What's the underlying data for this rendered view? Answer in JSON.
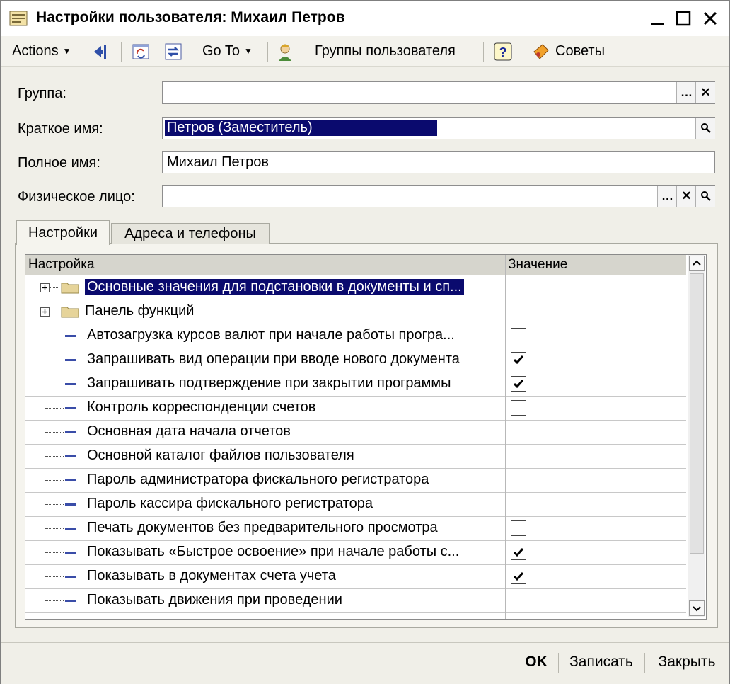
{
  "window": {
    "title": "Настройки пользователя: Михаил Петров"
  },
  "toolbar": {
    "actions": "Actions",
    "goto": "Go To",
    "groups": "Группы пользователя",
    "tips": "Советы"
  },
  "form": {
    "group_label": "Группа:",
    "group_value": "",
    "short_name_label": "Краткое имя:",
    "short_name_value": "Петров (Заместитель)",
    "full_name_label": "Полное имя:",
    "full_name_value": "Михаил Петров",
    "person_label": "Физическое лицо:",
    "person_value": ""
  },
  "tabs": [
    {
      "label": "Настройки",
      "active": true
    },
    {
      "label": "Адреса и телефоны",
      "active": false
    }
  ],
  "grid": {
    "col_setting": "Настройка",
    "col_value": "Значение",
    "rows": [
      {
        "label": "Основные значения для подстановки в документы и сп...",
        "kind": "folder",
        "selected": true,
        "checkbox": null
      },
      {
        "label": "Панель функций",
        "kind": "folder",
        "selected": false,
        "checkbox": null
      },
      {
        "label": "Автозагрузка курсов валют при начале работы програ...",
        "kind": "item",
        "checkbox": false
      },
      {
        "label": "Запрашивать вид операции при вводе нового документа",
        "kind": "item",
        "checkbox": true
      },
      {
        "label": "Запрашивать подтверждение при закрытии программы",
        "kind": "item",
        "checkbox": true
      },
      {
        "label": "Контроль корреспонденции счетов",
        "kind": "item",
        "checkbox": false
      },
      {
        "label": "Основная дата начала отчетов",
        "kind": "item",
        "checkbox": null
      },
      {
        "label": "Основной каталог файлов пользователя",
        "kind": "item",
        "checkbox": null
      },
      {
        "label": "Пароль администратора фискального регистратора",
        "kind": "item",
        "checkbox": null
      },
      {
        "label": "Пароль кассира фискального регистратора",
        "kind": "item",
        "checkbox": null
      },
      {
        "label": "Печать документов без предварительного просмотра",
        "kind": "item",
        "checkbox": false
      },
      {
        "label": "Показывать «Быстрое освоение» при начале работы с...",
        "kind": "item",
        "checkbox": true
      },
      {
        "label": "Показывать в документах счета учета",
        "kind": "item",
        "checkbox": true
      },
      {
        "label": "Показывать движения при проведении",
        "kind": "item",
        "checkbox": false
      }
    ]
  },
  "footer": {
    "ok": "OK",
    "save": "Записать",
    "close": "Закрыть"
  },
  "colors": {
    "selection": "#0a0a6e",
    "header_bg": "#d6d5cd",
    "window_bg": "#f0efe8"
  }
}
